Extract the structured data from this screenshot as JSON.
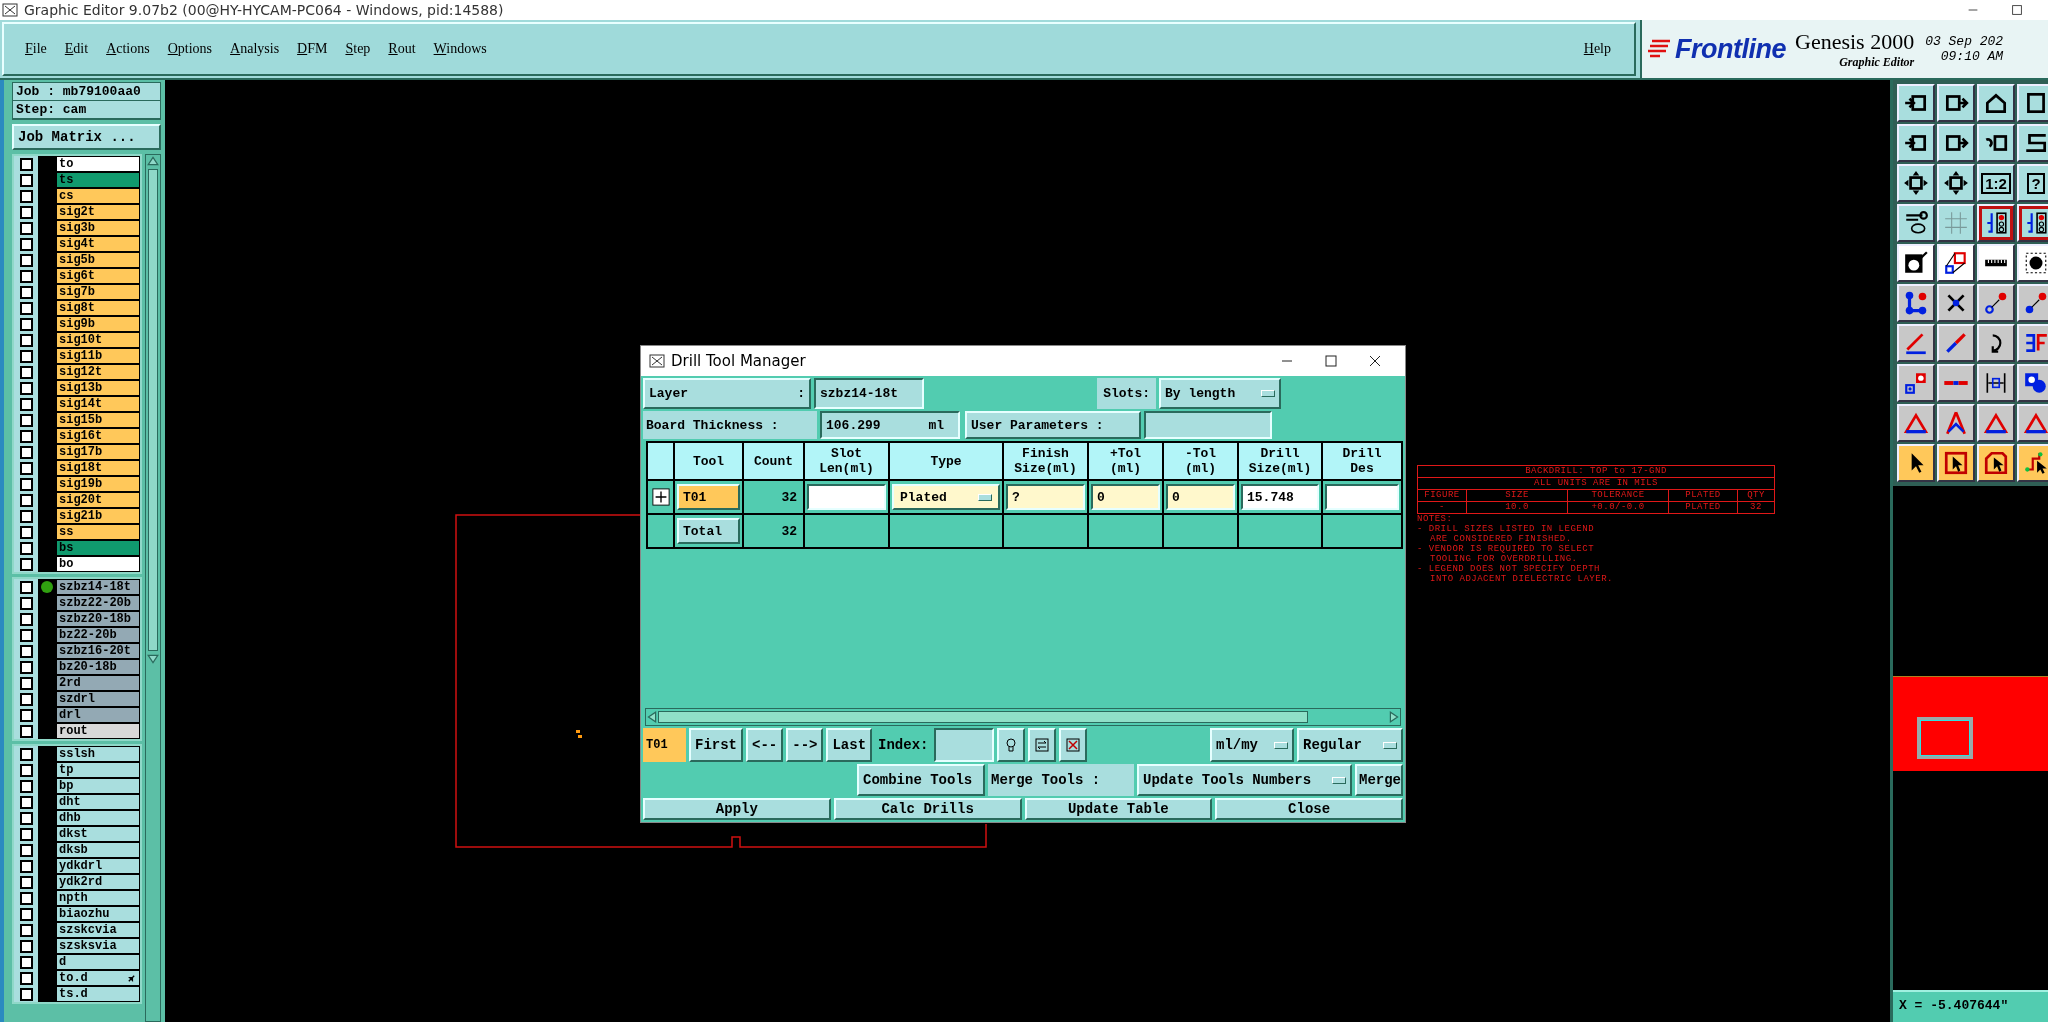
{
  "window": {
    "title": "Graphic Editor 9.07b2 (00@HY-HYCAM-PC064 - Windows, pid:14588)"
  },
  "menu": [
    {
      "label": "File"
    },
    {
      "label": "Edit"
    },
    {
      "label": "Actions"
    },
    {
      "label": "Options"
    },
    {
      "label": "Analysis"
    },
    {
      "label": "DFM"
    },
    {
      "label": "Step"
    },
    {
      "label": "Rout"
    },
    {
      "label": "Windows"
    }
  ],
  "help": "Help",
  "brand": {
    "logo": "Frontline",
    "product": "Genesis 2000",
    "subtitle": "Graphic Editor",
    "date": "03 Sep 202",
    "time": "09:10 AM"
  },
  "job_panel": {
    "job": "Job : mb79100aa0",
    "step": "Step: cam",
    "matrix_button": "Job Matrix ..."
  },
  "layer_groups": [
    {
      "layers": [
        {
          "name": "to",
          "color": "#ffffff",
          "checked": false,
          "active": false,
          "flag": false
        },
        {
          "name": "ts",
          "color": "#109a6e",
          "checked": false,
          "active": false,
          "flag": false
        },
        {
          "name": "cs",
          "color": "#ffc85a",
          "checked": false,
          "active": false,
          "flag": false
        },
        {
          "name": "sig2t",
          "color": "#ffc85a",
          "checked": false,
          "active": false,
          "flag": false
        },
        {
          "name": "sig3b",
          "color": "#ffc85a",
          "checked": false,
          "active": false,
          "flag": false
        },
        {
          "name": "sig4t",
          "color": "#ffc85a",
          "checked": false,
          "active": false,
          "flag": false
        },
        {
          "name": "sig5b",
          "color": "#ffc85a",
          "checked": false,
          "active": false,
          "flag": false
        },
        {
          "name": "sig6t",
          "color": "#ffc85a",
          "checked": false,
          "active": false,
          "flag": false
        },
        {
          "name": "sig7b",
          "color": "#ffc85a",
          "checked": false,
          "active": false,
          "flag": false
        },
        {
          "name": "sig8t",
          "color": "#ffc85a",
          "checked": false,
          "active": false,
          "flag": false
        },
        {
          "name": "sig9b",
          "color": "#ffc85a",
          "checked": false,
          "active": false,
          "flag": false
        },
        {
          "name": "sig10t",
          "color": "#ffc85a",
          "checked": false,
          "active": false,
          "flag": false
        },
        {
          "name": "sig11b",
          "color": "#ffc85a",
          "checked": false,
          "active": false,
          "flag": false
        },
        {
          "name": "sig12t",
          "color": "#ffc85a",
          "checked": false,
          "active": false,
          "flag": false
        },
        {
          "name": "sig13b",
          "color": "#ffc85a",
          "checked": false,
          "active": false,
          "flag": false
        },
        {
          "name": "sig14t",
          "color": "#ffc85a",
          "checked": false,
          "active": false,
          "flag": false
        },
        {
          "name": "sig15b",
          "color": "#ffc85a",
          "checked": false,
          "active": false,
          "flag": false
        },
        {
          "name": "sig16t",
          "color": "#ffc85a",
          "checked": false,
          "active": false,
          "flag": false
        },
        {
          "name": "sig17b",
          "color": "#ffc85a",
          "checked": false,
          "active": false,
          "flag": false
        },
        {
          "name": "sig18t",
          "color": "#ffc85a",
          "checked": false,
          "active": false,
          "flag": false
        },
        {
          "name": "sig19b",
          "color": "#ffc85a",
          "checked": false,
          "active": false,
          "flag": false
        },
        {
          "name": "sig20t",
          "color": "#ffc85a",
          "checked": false,
          "active": false,
          "flag": false
        },
        {
          "name": "sig21b",
          "color": "#ffc85a",
          "checked": false,
          "active": false,
          "flag": false
        },
        {
          "name": "ss",
          "color": "#ffc85a",
          "checked": false,
          "active": false,
          "flag": false
        },
        {
          "name": "bs",
          "color": "#109a6e",
          "checked": false,
          "active": false,
          "flag": false
        },
        {
          "name": "bo",
          "color": "#ffffff",
          "checked": false,
          "active": false,
          "flag": false
        }
      ]
    },
    {
      "layers": [
        {
          "name": "szbz14-18t",
          "color": "#93a9b4",
          "checked": false,
          "active": true,
          "flag": false
        },
        {
          "name": "szbz22-20b",
          "color": "#93a9b4",
          "checked": false,
          "active": false,
          "flag": false
        },
        {
          "name": "szbz20-18b",
          "color": "#93a9b4",
          "checked": false,
          "active": false,
          "flag": false
        },
        {
          "name": "bz22-20b",
          "color": "#93a9b4",
          "checked": false,
          "active": false,
          "flag": false
        },
        {
          "name": "szbz16-20t",
          "color": "#93a9b4",
          "checked": false,
          "active": false,
          "flag": false
        },
        {
          "name": "bz20-18b",
          "color": "#93a9b4",
          "checked": false,
          "active": false,
          "flag": false
        },
        {
          "name": "2rd",
          "color": "#93a9b4",
          "checked": false,
          "active": false,
          "flag": false
        },
        {
          "name": "szdrl",
          "color": "#93a9b4",
          "checked": false,
          "active": false,
          "flag": false
        },
        {
          "name": "drl",
          "color": "#93a9b4",
          "checked": false,
          "active": false,
          "flag": false
        },
        {
          "name": "rout",
          "color": "#d8d8d8",
          "checked": false,
          "active": false,
          "flag": false
        }
      ]
    },
    {
      "layers": [
        {
          "name": "sslsh",
          "color": "#a9dede",
          "checked": false,
          "active": false,
          "flag": false
        },
        {
          "name": "tp",
          "color": "#a9dede",
          "checked": false,
          "active": false,
          "flag": false
        },
        {
          "name": "bp",
          "color": "#a9dede",
          "checked": false,
          "active": false,
          "flag": false
        },
        {
          "name": "dht",
          "color": "#a9dede",
          "checked": false,
          "active": false,
          "flag": false
        },
        {
          "name": "dhb",
          "color": "#a9dede",
          "checked": false,
          "active": false,
          "flag": false
        },
        {
          "name": "dkst",
          "color": "#a9dede",
          "checked": false,
          "active": false,
          "flag": false
        },
        {
          "name": "dksb",
          "color": "#a9dede",
          "checked": false,
          "active": false,
          "flag": false
        },
        {
          "name": "ydkdrl",
          "color": "#a9dede",
          "checked": false,
          "active": false,
          "flag": false
        },
        {
          "name": "ydk2rd",
          "color": "#a9dede",
          "checked": false,
          "active": false,
          "flag": false
        },
        {
          "name": "npth",
          "color": "#a9dede",
          "checked": false,
          "active": false,
          "flag": false
        },
        {
          "name": "biaozhu",
          "color": "#a9dede",
          "checked": false,
          "active": false,
          "flag": false
        },
        {
          "name": "szskcvia",
          "color": "#a9dede",
          "checked": false,
          "active": false,
          "flag": false
        },
        {
          "name": "szsksvia",
          "color": "#a9dede",
          "checked": false,
          "active": false,
          "flag": false
        },
        {
          "name": "d",
          "color": "#a9dede",
          "checked": false,
          "active": false,
          "flag": false
        },
        {
          "name": "to.d",
          "color": "#a9dede",
          "checked": false,
          "active": false,
          "flag": true
        },
        {
          "name": "ts.d",
          "color": "#a9dede",
          "checked": false,
          "active": false,
          "flag": false
        }
      ]
    }
  ],
  "canvas": {
    "notes_table": {
      "title": "BACKDRILL: TOP to 17-GND",
      "subtitle": "ALL UNITS ARE IN MILS",
      "columns": [
        "FIGURE",
        "SIZE",
        "TOLERANCE",
        "PLATED",
        "QTY"
      ],
      "row": [
        "-",
        "10.0",
        "+0.0/-0.0",
        "PLATED",
        "32"
      ]
    },
    "notes": [
      {
        "kind": "heading",
        "text": "NOTES:"
      },
      {
        "kind": "bullet",
        "text": "- DRILL SIZES LISTED IN LEGEND"
      },
      {
        "kind": "continuation",
        "text": "ARE CONSIDERED FINISHED."
      },
      {
        "kind": "bullet",
        "text": "- VENDOR IS REQUIRED TO SELECT"
      },
      {
        "kind": "continuation",
        "text": "TOOLING FOR OVERDRILLING."
      },
      {
        "kind": "bullet",
        "text": "- LEGEND DOES NOT SPECIFY DEPTH"
      },
      {
        "kind": "continuation",
        "text": "INTO ADJACENT DIELECTRIC LAYER."
      }
    ]
  },
  "toolbar": {
    "labels": [
      "1:2",
      "?"
    ]
  },
  "dialog": {
    "title": "Drill Tool Manager",
    "layer_label": "Layer",
    "layer_colon": ":",
    "layer_value": "szbz14-18t",
    "slots_label": "Slots:",
    "slots_value": "By length",
    "thickness_label": "Board Thickness :",
    "thickness_value": "106.299",
    "thickness_unit": "ml",
    "user_params_label": "User Parameters :",
    "columns": [
      {
        "lines": [
          "Tool"
        ]
      },
      {
        "lines": [
          "Count"
        ]
      },
      {
        "lines": [
          "Slot",
          "Len(ml)"
        ]
      },
      {
        "lines": [
          "Type"
        ]
      },
      {
        "lines": [
          "Finish",
          "Size(ml)"
        ]
      },
      {
        "lines": [
          "+Tol",
          "(ml)"
        ]
      },
      {
        "lines": [
          "-Tol",
          "(ml)"
        ]
      },
      {
        "lines": [
          "Drill",
          "Size(ml)"
        ]
      },
      {
        "lines": [
          "Drill",
          "Des"
        ]
      }
    ],
    "rows": [
      {
        "selected": true,
        "expandable": true,
        "cells": [
          {
            "kind": "tool",
            "text": "T01"
          },
          {
            "kind": "number",
            "text": "32"
          },
          {
            "kind": "field",
            "tinted": false
          },
          {
            "kind": "dropdown",
            "text": "Plated"
          },
          {
            "kind": "field",
            "tinted": true,
            "text": "?"
          },
          {
            "kind": "field",
            "tinted": true,
            "text": "0"
          },
          {
            "kind": "field",
            "tinted": true,
            "text": "0"
          },
          {
            "kind": "field",
            "tinted": false,
            "text": "15.748"
          },
          {
            "kind": "field",
            "tinted": false
          }
        ]
      },
      {
        "selected": false,
        "expandable": false,
        "cells": [
          {
            "kind": "tool",
            "text": "Total"
          },
          {
            "kind": "number",
            "text": "32"
          }
        ]
      }
    ],
    "nav": {
      "current": "T01",
      "buttons": [
        "First",
        "<--",
        "-->",
        "Last"
      ],
      "index_label": "Index:",
      "units": "ml/my",
      "mode": "Regular"
    },
    "merge": {
      "combine": "Combine Tools",
      "merge_label": "Merge Tools :",
      "merge_mode": "Update Tools Numbers",
      "merge_button": "Merge"
    },
    "actions": [
      "Apply",
      "Calc Drills",
      "Update Table",
      "Close"
    ]
  },
  "coordinates": {
    "x": "X = -5.407644\""
  }
}
